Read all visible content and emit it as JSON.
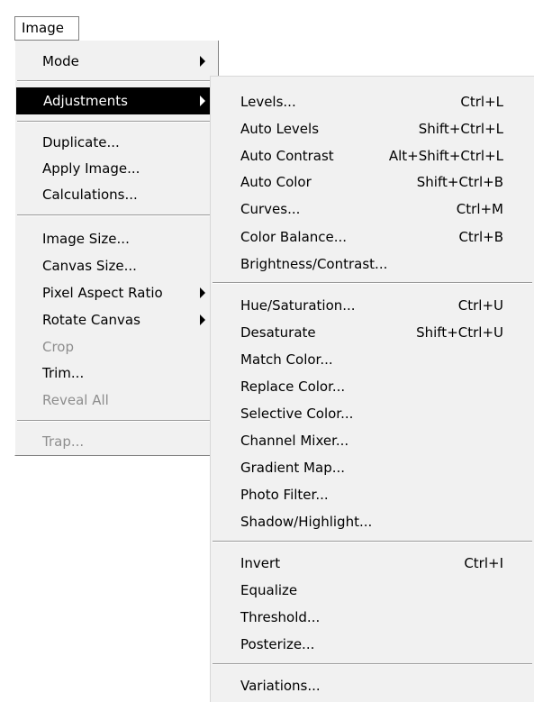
{
  "menubar": {
    "title": "Image"
  },
  "image_menu": {
    "mode": "Mode",
    "adjustments": "Adjustments",
    "duplicate": "Duplicate...",
    "apply_image": "Apply Image...",
    "calculations": "Calculations...",
    "image_size": "Image Size...",
    "canvas_size": "Canvas Size...",
    "pixel_aspect_ratio": "Pixel Aspect Ratio",
    "rotate_canvas": "Rotate Canvas",
    "crop": "Crop",
    "trim": "Trim...",
    "reveal_all": "Reveal All",
    "trap": "Trap..."
  },
  "adjustments_menu": {
    "levels": {
      "label": "Levels...",
      "shortcut": "Ctrl+L"
    },
    "auto_levels": {
      "label": "Auto Levels",
      "shortcut": "Shift+Ctrl+L"
    },
    "auto_contrast": {
      "label": "Auto Contrast",
      "shortcut": "Alt+Shift+Ctrl+L"
    },
    "auto_color": {
      "label": "Auto Color",
      "shortcut": "Shift+Ctrl+B"
    },
    "curves": {
      "label": "Curves...",
      "shortcut": "Ctrl+M"
    },
    "color_balance": {
      "label": "Color Balance...",
      "shortcut": "Ctrl+B"
    },
    "brightness_contrast": {
      "label": "Brightness/Contrast..."
    },
    "hue_saturation": {
      "label": "Hue/Saturation...",
      "shortcut": "Ctrl+U"
    },
    "desaturate": {
      "label": "Desaturate",
      "shortcut": "Shift+Ctrl+U"
    },
    "match_color": {
      "label": "Match Color..."
    },
    "replace_color": {
      "label": "Replace Color..."
    },
    "selective_color": {
      "label": "Selective Color..."
    },
    "channel_mixer": {
      "label": "Channel Mixer..."
    },
    "gradient_map": {
      "label": "Gradient Map..."
    },
    "photo_filter": {
      "label": "Photo Filter..."
    },
    "shadow_highlight": {
      "label": "Shadow/Highlight..."
    },
    "invert": {
      "label": "Invert",
      "shortcut": "Ctrl+I"
    },
    "equalize": {
      "label": "Equalize"
    },
    "threshold": {
      "label": "Threshold..."
    },
    "posterize": {
      "label": "Posterize..."
    },
    "variations": {
      "label": "Variations..."
    }
  }
}
